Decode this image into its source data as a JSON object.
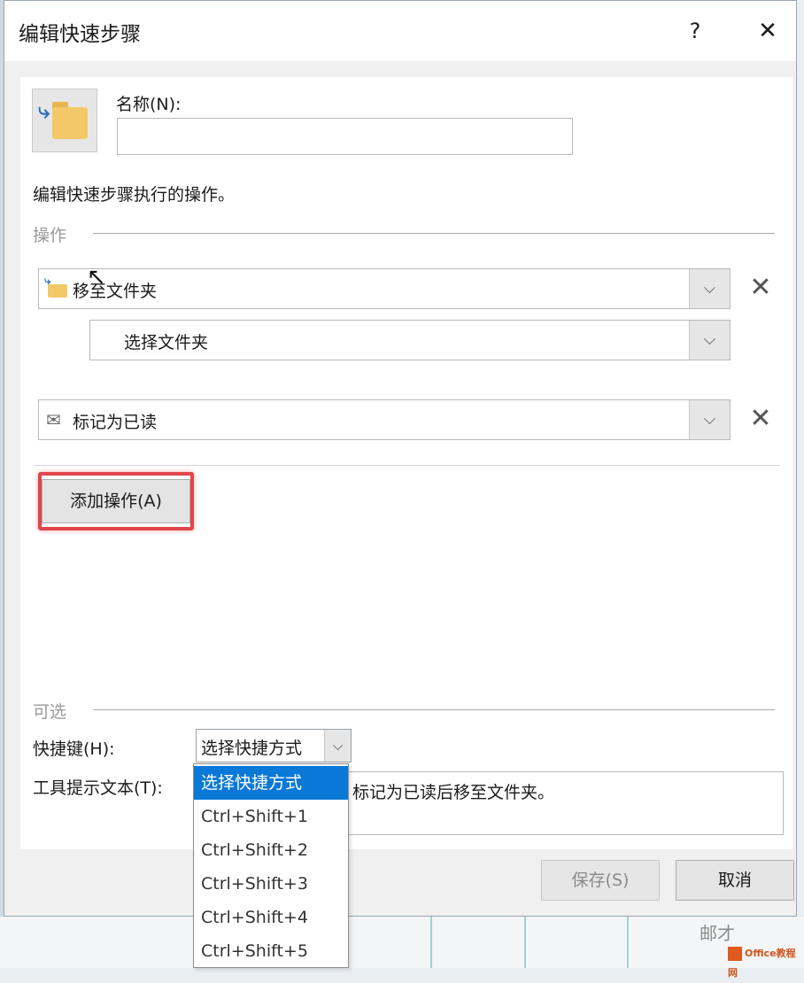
{
  "dialog": {
    "title": "编辑快速步骤",
    "help_glyph": "?",
    "close_glyph": "✕"
  },
  "name_section": {
    "label": "名称(N):",
    "input_value": ""
  },
  "description": "编辑快速步骤执行的操作。",
  "actions_group": {
    "label": "操作",
    "action_1": {
      "value": "移至文件夹",
      "icon": "folder-move-icon"
    },
    "action_1_sub": {
      "value": "选择文件夹"
    },
    "action_2": {
      "value": "标记为已读",
      "icon": "envelope-open-icon"
    },
    "delete_glyph": "✕",
    "dropdown_glyph": "⌵",
    "add_button": "添加操作(A)"
  },
  "optional_group": {
    "label": "可选",
    "hotkey_label": "快捷键(H):",
    "hotkey_value": "选择快捷方式",
    "tooltip_label": "工具提示文本(T):",
    "tooltip_value": "标记为已读后移至文件夹。"
  },
  "hotkey_options": [
    "选择快捷方式",
    "Ctrl+Shift+1",
    "Ctrl+Shift+2",
    "Ctrl+Shift+3",
    "Ctrl+Shift+4",
    "Ctrl+Shift+5"
  ],
  "footer": {
    "save": "保存(S)",
    "cancel": "取消"
  },
  "watermark": {
    "text": "邮才",
    "logo_text": "Office教程网"
  },
  "colors": {
    "accent_selected": "#0a78d7",
    "highlight": "#e0464c"
  }
}
